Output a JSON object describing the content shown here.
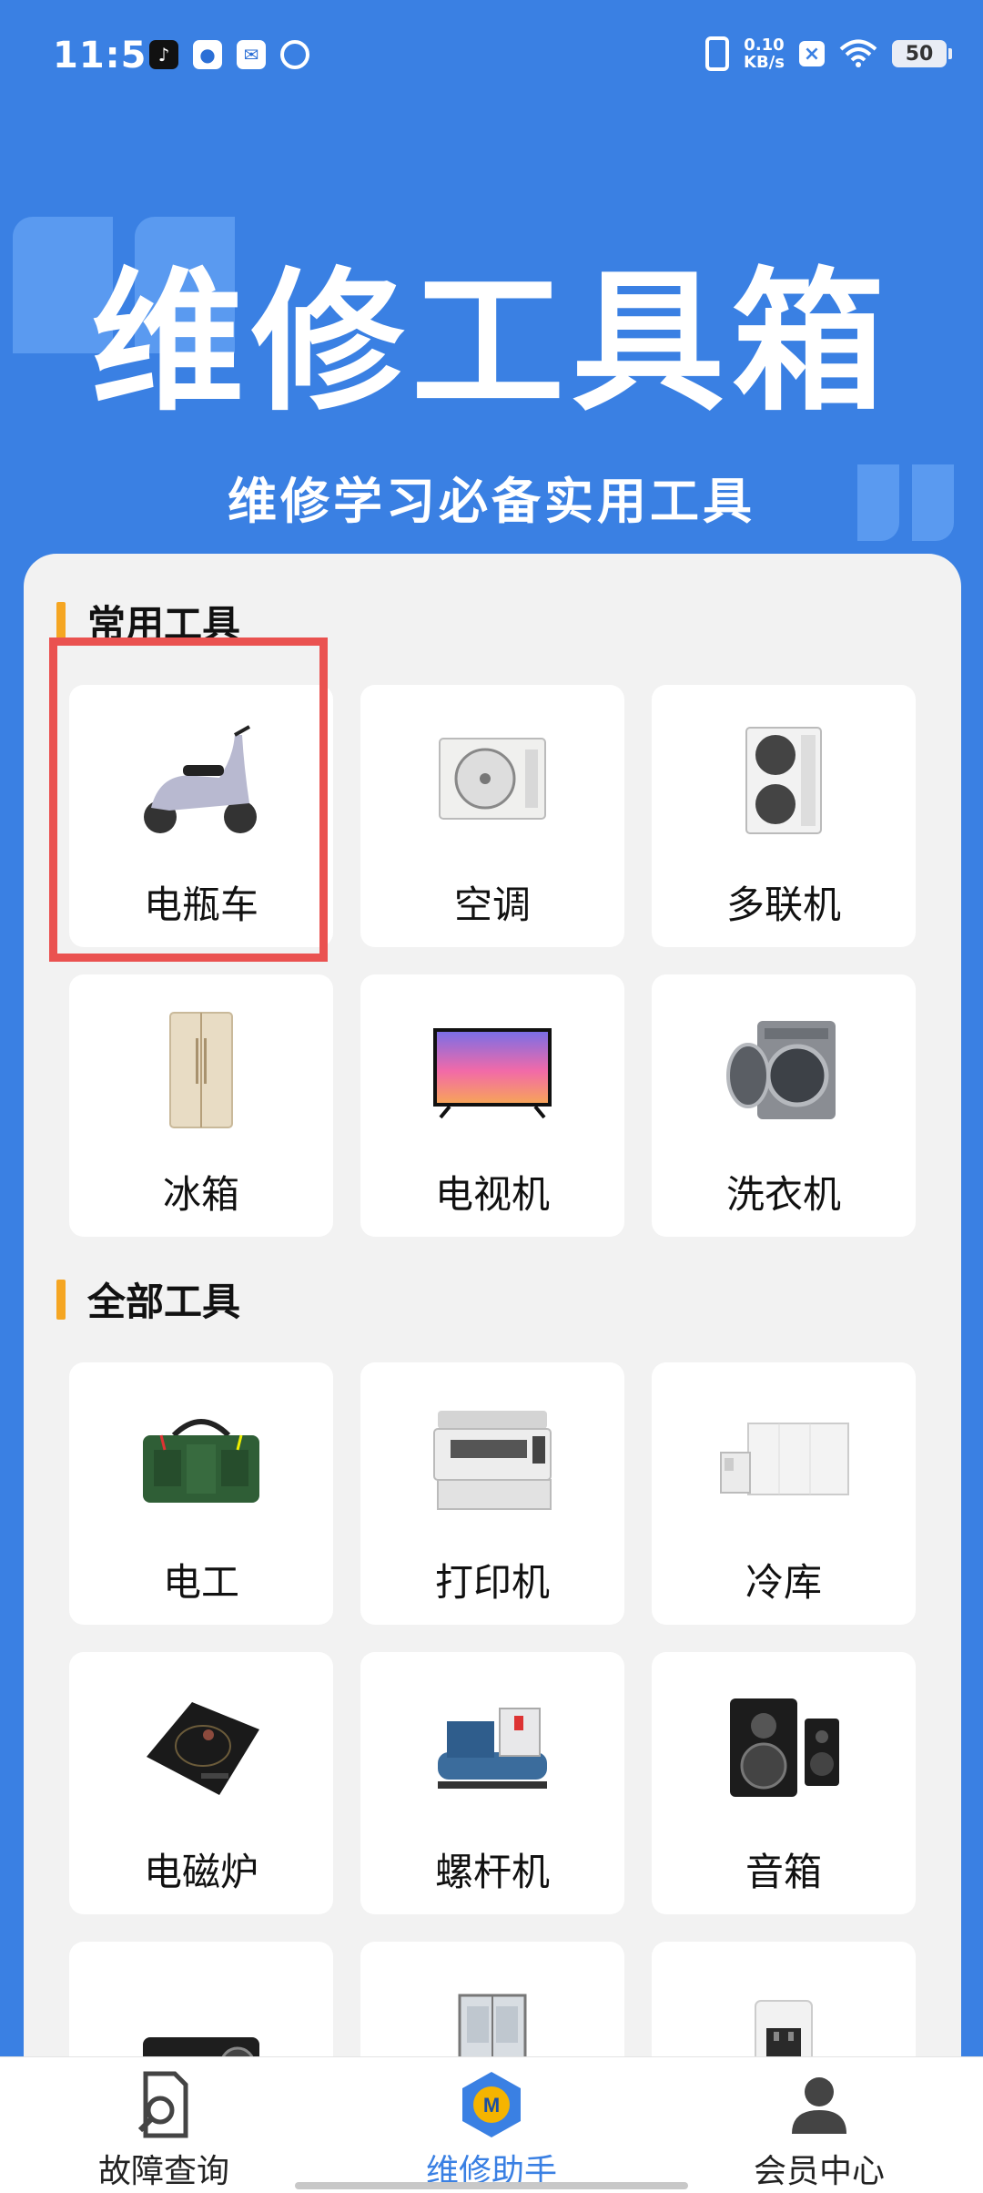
{
  "status_bar": {
    "time": "11:51",
    "net_speed_value": "0.10",
    "net_speed_unit": "KB/s",
    "battery": "50",
    "icons": [
      "tiktok-icon",
      "app-icon",
      "mail-icon",
      "swirl-icon",
      "vibrate-icon",
      "x-icon",
      "wifi-icon",
      "battery-icon"
    ]
  },
  "hero": {
    "title": "维修工具箱",
    "subtitle": "维修学习必备实用工具"
  },
  "common_tools": {
    "header": "常用工具",
    "items": [
      {
        "label": "电瓶车",
        "icon": "scooter-icon"
      },
      {
        "label": "空调",
        "icon": "air-conditioner-icon"
      },
      {
        "label": "多联机",
        "icon": "vrf-unit-icon"
      },
      {
        "label": "冰箱",
        "icon": "fridge-icon"
      },
      {
        "label": "电视机",
        "icon": "tv-icon"
      },
      {
        "label": "洗衣机",
        "icon": "washing-machine-icon"
      }
    ]
  },
  "all_tools": {
    "header": "全部工具",
    "items": [
      {
        "label": "电工",
        "icon": "tool-bag-icon"
      },
      {
        "label": "打印机",
        "icon": "printer-icon"
      },
      {
        "label": "冷库",
        "icon": "cold-storage-icon"
      },
      {
        "label": "电磁炉",
        "icon": "induction-cooker-icon"
      },
      {
        "label": "螺杆机",
        "icon": "screw-chiller-icon"
      },
      {
        "label": "音箱",
        "icon": "speaker-icon"
      },
      {
        "label": "",
        "icon": "projector-icon"
      },
      {
        "label": "",
        "icon": "elevator-icon"
      },
      {
        "label": "",
        "icon": "water-dispenser-icon"
      }
    ]
  },
  "bottom_nav": {
    "items": [
      {
        "label": "故障查询",
        "icon": "fault-search-icon",
        "active": false
      },
      {
        "label": "维修助手",
        "icon": "repair-assistant-icon",
        "active": true
      },
      {
        "label": "会员中心",
        "icon": "member-icon",
        "active": false
      }
    ]
  },
  "colors": {
    "brand_blue": "#3a80e3",
    "accent_orange": "#f5a623",
    "highlight_red": "#ea5250"
  }
}
